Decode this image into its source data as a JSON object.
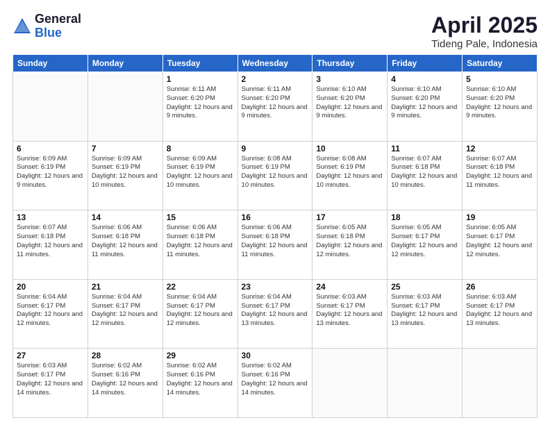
{
  "logo": {
    "general": "General",
    "blue": "Blue"
  },
  "title": {
    "month_year": "April 2025",
    "location": "Tideng Pale, Indonesia"
  },
  "header_days": [
    "Sunday",
    "Monday",
    "Tuesday",
    "Wednesday",
    "Thursday",
    "Friday",
    "Saturday"
  ],
  "weeks": [
    [
      {
        "day": "",
        "info": ""
      },
      {
        "day": "",
        "info": ""
      },
      {
        "day": "1",
        "info": "Sunrise: 6:11 AM\nSunset: 6:20 PM\nDaylight: 12 hours and 9 minutes."
      },
      {
        "day": "2",
        "info": "Sunrise: 6:11 AM\nSunset: 6:20 PM\nDaylight: 12 hours and 9 minutes."
      },
      {
        "day": "3",
        "info": "Sunrise: 6:10 AM\nSunset: 6:20 PM\nDaylight: 12 hours and 9 minutes."
      },
      {
        "day": "4",
        "info": "Sunrise: 6:10 AM\nSunset: 6:20 PM\nDaylight: 12 hours and 9 minutes."
      },
      {
        "day": "5",
        "info": "Sunrise: 6:10 AM\nSunset: 6:20 PM\nDaylight: 12 hours and 9 minutes."
      }
    ],
    [
      {
        "day": "6",
        "info": "Sunrise: 6:09 AM\nSunset: 6:19 PM\nDaylight: 12 hours and 9 minutes."
      },
      {
        "day": "7",
        "info": "Sunrise: 6:09 AM\nSunset: 6:19 PM\nDaylight: 12 hours and 10 minutes."
      },
      {
        "day": "8",
        "info": "Sunrise: 6:09 AM\nSunset: 6:19 PM\nDaylight: 12 hours and 10 minutes."
      },
      {
        "day": "9",
        "info": "Sunrise: 6:08 AM\nSunset: 6:19 PM\nDaylight: 12 hours and 10 minutes."
      },
      {
        "day": "10",
        "info": "Sunrise: 6:08 AM\nSunset: 6:19 PM\nDaylight: 12 hours and 10 minutes."
      },
      {
        "day": "11",
        "info": "Sunrise: 6:07 AM\nSunset: 6:18 PM\nDaylight: 12 hours and 10 minutes."
      },
      {
        "day": "12",
        "info": "Sunrise: 6:07 AM\nSunset: 6:18 PM\nDaylight: 12 hours and 11 minutes."
      }
    ],
    [
      {
        "day": "13",
        "info": "Sunrise: 6:07 AM\nSunset: 6:18 PM\nDaylight: 12 hours and 11 minutes."
      },
      {
        "day": "14",
        "info": "Sunrise: 6:06 AM\nSunset: 6:18 PM\nDaylight: 12 hours and 11 minutes."
      },
      {
        "day": "15",
        "info": "Sunrise: 6:06 AM\nSunset: 6:18 PM\nDaylight: 12 hours and 11 minutes."
      },
      {
        "day": "16",
        "info": "Sunrise: 6:06 AM\nSunset: 6:18 PM\nDaylight: 12 hours and 11 minutes."
      },
      {
        "day": "17",
        "info": "Sunrise: 6:05 AM\nSunset: 6:18 PM\nDaylight: 12 hours and 12 minutes."
      },
      {
        "day": "18",
        "info": "Sunrise: 6:05 AM\nSunset: 6:17 PM\nDaylight: 12 hours and 12 minutes."
      },
      {
        "day": "19",
        "info": "Sunrise: 6:05 AM\nSunset: 6:17 PM\nDaylight: 12 hours and 12 minutes."
      }
    ],
    [
      {
        "day": "20",
        "info": "Sunrise: 6:04 AM\nSunset: 6:17 PM\nDaylight: 12 hours and 12 minutes."
      },
      {
        "day": "21",
        "info": "Sunrise: 6:04 AM\nSunset: 6:17 PM\nDaylight: 12 hours and 12 minutes."
      },
      {
        "day": "22",
        "info": "Sunrise: 6:04 AM\nSunset: 6:17 PM\nDaylight: 12 hours and 12 minutes."
      },
      {
        "day": "23",
        "info": "Sunrise: 6:04 AM\nSunset: 6:17 PM\nDaylight: 12 hours and 13 minutes."
      },
      {
        "day": "24",
        "info": "Sunrise: 6:03 AM\nSunset: 6:17 PM\nDaylight: 12 hours and 13 minutes."
      },
      {
        "day": "25",
        "info": "Sunrise: 6:03 AM\nSunset: 6:17 PM\nDaylight: 12 hours and 13 minutes."
      },
      {
        "day": "26",
        "info": "Sunrise: 6:03 AM\nSunset: 6:17 PM\nDaylight: 12 hours and 13 minutes."
      }
    ],
    [
      {
        "day": "27",
        "info": "Sunrise: 6:03 AM\nSunset: 6:17 PM\nDaylight: 12 hours and 14 minutes."
      },
      {
        "day": "28",
        "info": "Sunrise: 6:02 AM\nSunset: 6:16 PM\nDaylight: 12 hours and 14 minutes."
      },
      {
        "day": "29",
        "info": "Sunrise: 6:02 AM\nSunset: 6:16 PM\nDaylight: 12 hours and 14 minutes."
      },
      {
        "day": "30",
        "info": "Sunrise: 6:02 AM\nSunset: 6:16 PM\nDaylight: 12 hours and 14 minutes."
      },
      {
        "day": "",
        "info": ""
      },
      {
        "day": "",
        "info": ""
      },
      {
        "day": "",
        "info": ""
      }
    ]
  ]
}
